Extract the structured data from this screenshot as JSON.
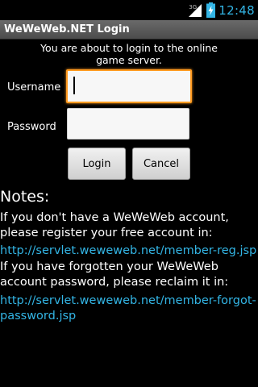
{
  "status_bar": {
    "network_label": "3G",
    "time": "12:48",
    "clock_color": "#33b5e5",
    "icons": [
      "signal-icon",
      "battery-charging-icon"
    ]
  },
  "title_bar": {
    "title": "WeWeWeb.NET Login"
  },
  "intro_text": "You are about to login to the online game server.",
  "form": {
    "username_label": "Username",
    "username_value": "",
    "password_label": "Password",
    "password_value": "",
    "login_button": "Login",
    "cancel_button": "Cancel",
    "focus_color": "#ff9a1f"
  },
  "notes": {
    "heading": "Notes:",
    "register_text": "If you don't have a WeWeWeb account, please register your free account in:",
    "register_link": "http://servlet.weweweb.net/member-reg.jsp",
    "forgot_text": "If you have forgotten your WeWeWeb account password, please reclaim it in:",
    "forgot_link": "http://servlet.weweweb.net/member-forgot-password.jsp",
    "link_color": "#33b5e5"
  }
}
